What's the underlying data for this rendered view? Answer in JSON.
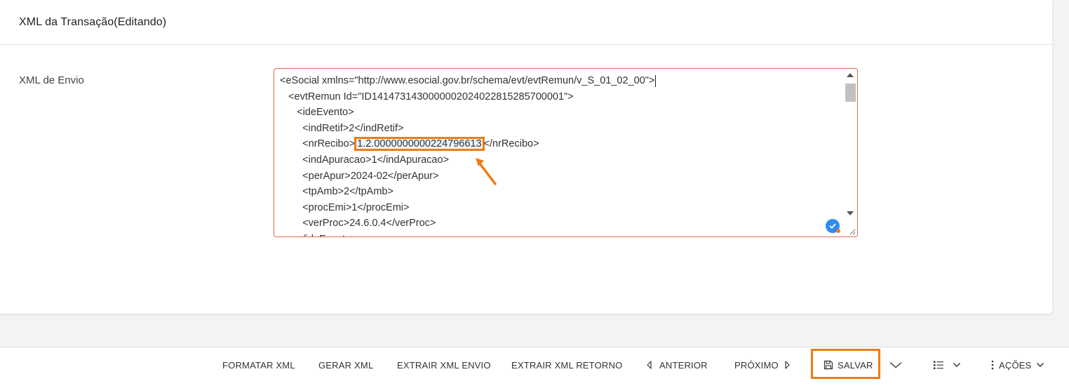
{
  "card": {
    "title": "XML da Transação(Editando)",
    "field_label": "XML de Envio"
  },
  "xml": {
    "lines": [
      "<eSocial xmlns=\"http://www.esocial.gov.br/schema/evt/evtRemun/v_S_01_02_00\">",
      "  <evtRemun Id=\"ID1414731430000002024022815285700001\">",
      "    <ideEvento>",
      "      <indRetif>2</indRetif>",
      "      <nrRecibo>",
      "1.2.0000000000224796613",
      "</nrRecibo>",
      "      <indApuracao>1</indApuracao>",
      "      <perApur>2024-02</perApur>",
      "      <tpAmb>2</tpAmb>",
      "      <procEmi>1</procEmi>",
      "      <verProc>24.6.0.4</verProc>",
      "    </ideEvento>"
    ]
  },
  "toolbar": {
    "formatar": "FORMATAR XML",
    "gerar": "GERAR XML",
    "extrair_envio": "EXTRAIR XML ENVIO",
    "extrair_retorno": "EXTRAIR XML RETORNO",
    "anterior": "ANTERIOR",
    "proximo": "PRÓXIMO",
    "salvar": "SALVAR",
    "acoes": "AÇÕES"
  },
  "colors": {
    "highlight": "#f07b13",
    "field_border": "#e06a52",
    "badge": "#2d8cf0"
  },
  "icons": [
    "chevron-left-icon",
    "chevron-right-icon",
    "save-icon",
    "chevron-down-icon",
    "list-icon",
    "more-vertical-icon",
    "check-icon",
    "resize-handle-icon"
  ]
}
